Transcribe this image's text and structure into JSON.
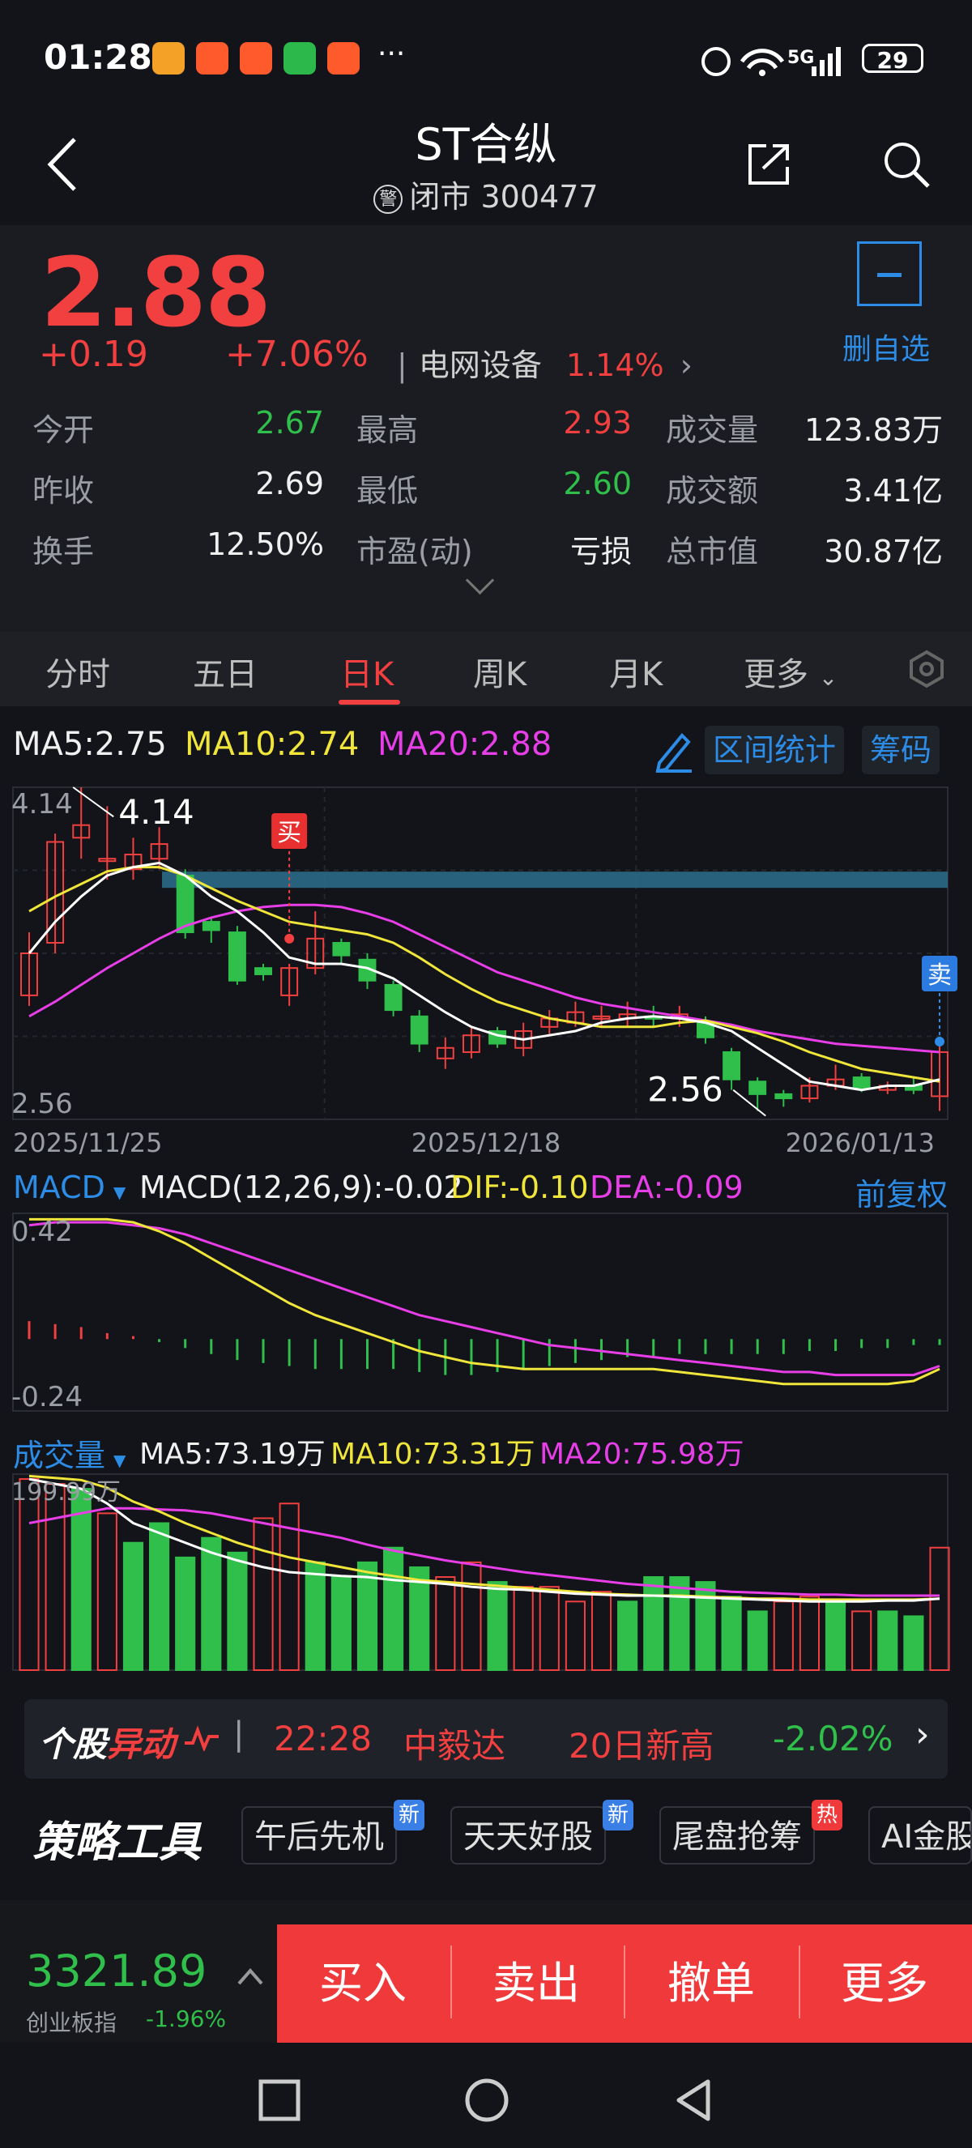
{
  "status_bar": {
    "time": "01:28",
    "battery": "29",
    "network": "5G"
  },
  "header": {
    "title": "ST合纵",
    "badge": "警",
    "subtitle": "闭市 300477"
  },
  "quote": {
    "price": "2.88",
    "change": "+0.19",
    "change_pct": "+7.06%",
    "industry": "电网设备",
    "industry_pct": "1.14%",
    "watchlist_label": "删自选"
  },
  "stats": [
    {
      "label": "今开",
      "value": "2.67",
      "color": "green"
    },
    {
      "label": "最高",
      "value": "2.93",
      "color": "red"
    },
    {
      "label": "成交量",
      "value": "123.83万",
      "color": "white"
    },
    {
      "label": "昨收",
      "value": "2.69",
      "color": "white"
    },
    {
      "label": "最低",
      "value": "2.60",
      "color": "green"
    },
    {
      "label": "成交额",
      "value": "3.41亿",
      "color": "white"
    },
    {
      "label": "换手",
      "value": "12.50%",
      "color": "white"
    },
    {
      "label": "市盈(动)",
      "value": "亏损",
      "color": "white"
    },
    {
      "label": "总市值",
      "value": "30.87亿",
      "color": "white"
    }
  ],
  "tabs": [
    "分时",
    "五日",
    "日K",
    "周K",
    "月K",
    "更多"
  ],
  "active_tab": "日K",
  "ma_legend": {
    "ma5": "MA5:2.75",
    "ma10": "MA10:2.74",
    "ma20": "MA20:2.88"
  },
  "kline_tools": {
    "range_stats": "区间统计",
    "chips": "筹码"
  },
  "colors": {
    "up": "#f23f3f",
    "down": "#2fbf4a",
    "ma5": "#ffffff",
    "ma10": "#f0e53a",
    "ma20": "#e83ee8",
    "accent": "#2c8ce6"
  },
  "chart_data": [
    {
      "type": "candlestick",
      "axis_top_label": "4.14",
      "axis_bottom_label": "2.56",
      "high_label": "4.14",
      "low_label": "2.56",
      "buy_marker": "买",
      "sell_marker": "卖",
      "dates": [
        "2025/11/25",
        "2025/12/18",
        "2026/01/13"
      ],
      "ylim": [
        2.56,
        4.14
      ],
      "candles": [
        {
          "o": 3.15,
          "c": 3.35,
          "h": 3.45,
          "l": 3.1
        },
        {
          "o": 3.4,
          "c": 3.88,
          "h": 3.92,
          "l": 3.35
        },
        {
          "o": 3.9,
          "c": 3.96,
          "h": 4.14,
          "l": 3.8
        },
        {
          "o": 3.8,
          "c": 3.8,
          "h": 4.05,
          "l": 3.7
        },
        {
          "o": 3.75,
          "c": 3.82,
          "h": 3.9,
          "l": 3.7
        },
        {
          "o": 3.8,
          "c": 3.87,
          "h": 3.95,
          "l": 3.75
        },
        {
          "o": 3.72,
          "c": 3.45,
          "h": 3.75,
          "l": 3.42
        },
        {
          "o": 3.5,
          "c": 3.46,
          "h": 3.52,
          "l": 3.4
        },
        {
          "o": 3.45,
          "c": 3.22,
          "h": 3.48,
          "l": 3.2
        },
        {
          "o": 3.28,
          "c": 3.25,
          "h": 3.3,
          "l": 3.22
        },
        {
          "o": 3.15,
          "c": 3.28,
          "h": 3.3,
          "l": 3.1
        },
        {
          "o": 3.28,
          "c": 3.42,
          "h": 3.55,
          "l": 3.25
        },
        {
          "o": 3.4,
          "c": 3.34,
          "h": 3.42,
          "l": 3.3
        },
        {
          "o": 3.32,
          "c": 3.22,
          "h": 3.35,
          "l": 3.18
        },
        {
          "o": 3.2,
          "c": 3.08,
          "h": 3.22,
          "l": 3.05
        },
        {
          "o": 3.05,
          "c": 2.92,
          "h": 3.08,
          "l": 2.88
        },
        {
          "o": 2.85,
          "c": 2.9,
          "h": 2.95,
          "l": 2.8
        },
        {
          "o": 2.88,
          "c": 2.96,
          "h": 3.0,
          "l": 2.85
        },
        {
          "o": 2.98,
          "c": 2.92,
          "h": 3.0,
          "l": 2.9
        },
        {
          "o": 2.9,
          "c": 2.98,
          "h": 3.02,
          "l": 2.86
        },
        {
          "o": 3.0,
          "c": 3.04,
          "h": 3.08,
          "l": 2.96
        },
        {
          "o": 3.02,
          "c": 3.07,
          "h": 3.12,
          "l": 3.0
        },
        {
          "o": 3.05,
          "c": 3.05,
          "h": 3.1,
          "l": 3.0
        },
        {
          "o": 3.04,
          "c": 3.06,
          "h": 3.12,
          "l": 3.0
        },
        {
          "o": 3.05,
          "c": 3.04,
          "h": 3.1,
          "l": 3.0
        },
        {
          "o": 3.04,
          "c": 3.06,
          "h": 3.1,
          "l": 3.0
        },
        {
          "o": 3.02,
          "c": 2.95,
          "h": 3.05,
          "l": 2.92
        },
        {
          "o": 2.88,
          "c": 2.75,
          "h": 2.9,
          "l": 2.7
        },
        {
          "o": 2.74,
          "c": 2.68,
          "h": 2.76,
          "l": 2.6
        },
        {
          "o": 2.68,
          "c": 2.66,
          "h": 2.7,
          "l": 2.62
        },
        {
          "o": 2.66,
          "c": 2.72,
          "h": 2.76,
          "l": 2.64
        },
        {
          "o": 2.72,
          "c": 2.75,
          "h": 2.82,
          "l": 2.7
        },
        {
          "o": 2.76,
          "c": 2.71,
          "h": 2.78,
          "l": 2.69
        },
        {
          "o": 2.7,
          "c": 2.72,
          "h": 2.74,
          "l": 2.68
        },
        {
          "o": 2.72,
          "c": 2.7,
          "h": 2.76,
          "l": 2.68
        },
        {
          "o": 2.67,
          "c": 2.88,
          "h": 2.93,
          "l": 2.6
        }
      ],
      "ma5": [
        3.35,
        3.5,
        3.62,
        3.72,
        3.76,
        3.78,
        3.72,
        3.62,
        3.55,
        3.45,
        3.33,
        3.3,
        3.3,
        3.28,
        3.23,
        3.15,
        3.07,
        3.0,
        2.96,
        2.94,
        2.96,
        2.98,
        3.02,
        3.04,
        3.05,
        3.04,
        3.02,
        2.98,
        2.9,
        2.82,
        2.74,
        2.72,
        2.7,
        2.72,
        2.72,
        2.75
      ],
      "ma10": [
        3.55,
        3.62,
        3.68,
        3.74,
        3.76,
        3.76,
        3.72,
        3.66,
        3.6,
        3.55,
        3.5,
        3.48,
        3.46,
        3.44,
        3.4,
        3.33,
        3.25,
        3.18,
        3.12,
        3.08,
        3.04,
        3.02,
        3.0,
        3.0,
        3.0,
        3.02,
        3.03,
        3.0,
        2.97,
        2.93,
        2.88,
        2.84,
        2.8,
        2.78,
        2.76,
        2.74
      ],
      "ma20": [
        3.05,
        3.12,
        3.2,
        3.28,
        3.35,
        3.42,
        3.48,
        3.52,
        3.55,
        3.57,
        3.58,
        3.58,
        3.57,
        3.54,
        3.5,
        3.44,
        3.38,
        3.32,
        3.26,
        3.22,
        3.18,
        3.14,
        3.11,
        3.09,
        3.07,
        3.05,
        3.03,
        3.01,
        2.98,
        2.96,
        2.94,
        2.92,
        2.91,
        2.9,
        2.89,
        2.88
      ]
    },
    {
      "type": "macd",
      "indicator_label": "MACD",
      "params_label": "MACD(12,26,9):-0.02",
      "dif_label": "DIF:-0.10",
      "dea_label": "DEA:-0.09",
      "adjust_label": "前复权",
      "ylim_labels": [
        "0.42",
        "-0.24"
      ],
      "ylim": [
        -0.24,
        0.42
      ],
      "hist": [
        0.06,
        0.05,
        0.04,
        0.02,
        0.01,
        -0.01,
        -0.03,
        -0.05,
        -0.07,
        -0.08,
        -0.09,
        -0.1,
        -0.1,
        -0.1,
        -0.1,
        -0.11,
        -0.12,
        -0.12,
        -0.11,
        -0.1,
        -0.09,
        -0.08,
        -0.07,
        -0.06,
        -0.06,
        -0.05,
        -0.05,
        -0.05,
        -0.05,
        -0.05,
        -0.04,
        -0.04,
        -0.03,
        -0.03,
        -0.02,
        -0.02
      ],
      "dif": [
        0.4,
        0.4,
        0.4,
        0.4,
        0.39,
        0.36,
        0.32,
        0.27,
        0.22,
        0.17,
        0.12,
        0.08,
        0.05,
        0.02,
        -0.01,
        -0.04,
        -0.06,
        -0.08,
        -0.09,
        -0.1,
        -0.1,
        -0.1,
        -0.1,
        -0.1,
        -0.1,
        -0.11,
        -0.12,
        -0.13,
        -0.14,
        -0.15,
        -0.15,
        -0.15,
        -0.15,
        -0.15,
        -0.14,
        -0.1
      ],
      "dea": [
        0.38,
        0.39,
        0.39,
        0.39,
        0.38,
        0.37,
        0.35,
        0.32,
        0.29,
        0.26,
        0.23,
        0.2,
        0.17,
        0.14,
        0.11,
        0.08,
        0.06,
        0.04,
        0.02,
        0.0,
        -0.02,
        -0.03,
        -0.04,
        -0.05,
        -0.06,
        -0.07,
        -0.08,
        -0.09,
        -0.1,
        -0.11,
        -0.11,
        -0.12,
        -0.12,
        -0.12,
        -0.12,
        -0.09
      ]
    },
    {
      "type": "volume_bar",
      "indicator_label": "成交量",
      "ma5_label": "MA5:73.19万",
      "ma10_label": "MA10:73.31万",
      "ma20_label": "MA20:75.98万",
      "ymax_label": "199.99万",
      "ylim": [
        0,
        200
      ],
      "volumes": [
        195,
        190,
        185,
        160,
        130,
        150,
        115,
        135,
        120,
        155,
        170,
        110,
        95,
        110,
        125,
        105,
        95,
        110,
        90,
        85,
        85,
        70,
        80,
        70,
        95,
        95,
        90,
        75,
        60,
        70,
        75,
        70,
        60,
        60,
        55,
        125
      ],
      "up": [
        true,
        true,
        false,
        true,
        false,
        false,
        false,
        false,
        false,
        true,
        true,
        false,
        false,
        false,
        false,
        false,
        true,
        true,
        false,
        true,
        true,
        true,
        true,
        false,
        false,
        false,
        false,
        false,
        false,
        true,
        true,
        false,
        true,
        false,
        false,
        true
      ],
      "ma5": [
        195,
        190,
        185,
        170,
        150,
        140,
        130,
        120,
        112,
        105,
        100,
        98,
        96,
        95,
        92,
        90,
        88,
        85,
        83,
        82,
        80,
        78,
        77,
        76,
        76,
        75,
        74,
        73,
        72,
        71,
        70,
        70,
        70,
        71,
        71,
        73
      ],
      "ma10": [
        198,
        196,
        194,
        186,
        172,
        162,
        150,
        140,
        130,
        122,
        115,
        110,
        105,
        100,
        96,
        92,
        90,
        88,
        86,
        84,
        82,
        80,
        78,
        77,
        76,
        76,
        75,
        74,
        73,
        73,
        72,
        72,
        72,
        72,
        72,
        73
      ],
      "ma20": [
        150,
        155,
        160,
        165,
        165,
        164,
        163,
        160,
        155,
        150,
        145,
        140,
        135,
        128,
        122,
        117,
        112,
        108,
        104,
        100,
        97,
        94,
        91,
        88,
        86,
        84,
        82,
        80,
        79,
        78,
        77,
        77,
        76,
        76,
        76,
        76
      ]
    }
  ],
  "ticker": {
    "brand1": "个股",
    "brand2": "异动",
    "time": "22:28",
    "stock": "中毅达",
    "event": "20日新高",
    "pct": "-2.02%"
  },
  "strategy": {
    "title": "策略工具",
    "tools": [
      {
        "label": "午后先机",
        "tag": "新"
      },
      {
        "label": "天天好股",
        "tag": "新"
      },
      {
        "label": "尾盘抢筹",
        "tag": "热"
      },
      {
        "label": "AI金股",
        "tag": ""
      }
    ]
  },
  "index": {
    "value": "3321.89",
    "name": "创业板指",
    "pct": "-1.96%"
  },
  "actions": [
    "买入",
    "卖出",
    "撤单",
    "更多"
  ]
}
